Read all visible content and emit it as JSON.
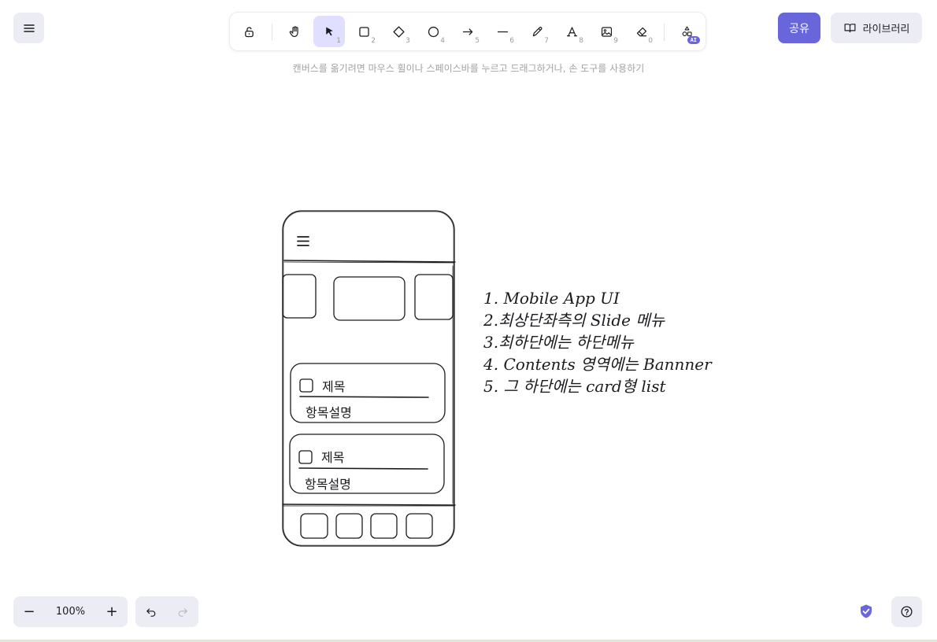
{
  "toolbar": {
    "tools": [
      {
        "name": "lock",
        "key": ""
      },
      {
        "name": "hand",
        "key": ""
      },
      {
        "name": "selection",
        "key": "1"
      },
      {
        "name": "rectangle",
        "key": "2"
      },
      {
        "name": "diamond",
        "key": "3"
      },
      {
        "name": "ellipse",
        "key": "4"
      },
      {
        "name": "arrow",
        "key": "5"
      },
      {
        "name": "line",
        "key": "6"
      },
      {
        "name": "draw",
        "key": "7"
      },
      {
        "name": "text",
        "key": "8"
      },
      {
        "name": "image",
        "key": "9"
      },
      {
        "name": "eraser",
        "key": "0"
      }
    ],
    "ai_badge": "AI"
  },
  "hint": "캔버스를 옮기려면 마우스 휠이나 스페이스바를 누르고 드래그하거나, 손 도구를 사용하기",
  "header": {
    "share_label": "공유",
    "library_label": "라이브러리"
  },
  "footer": {
    "zoom_level": "100%",
    "zoom_out": "−",
    "zoom_in": "+"
  },
  "canvas": {
    "cards": [
      {
        "title": "제목",
        "description": "항목설명"
      },
      {
        "title": "제목",
        "description": "항목설명"
      }
    ],
    "notes": [
      "1. Mobile App UI",
      "2.최상단좌측의 Slide 메뉴",
      "3.최하단에는 하단메뉴",
      "4. Contents 영역에는 Bannner",
      "5. 그 하단에는 card형 list"
    ]
  },
  "colors": {
    "accent": "#6965db",
    "active_tool": "#e0dfff",
    "island": "#ececf4"
  }
}
